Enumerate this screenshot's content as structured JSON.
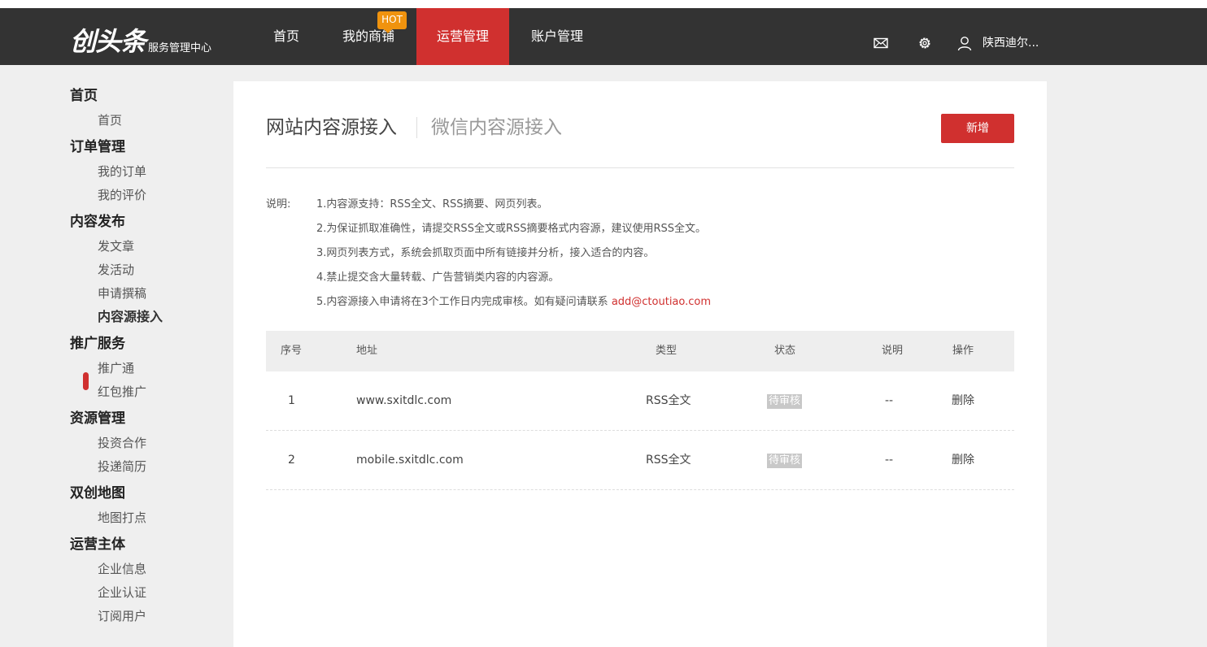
{
  "brand": {
    "name": "创头条",
    "subtitle": "服务管理中心"
  },
  "nav": {
    "items": [
      {
        "label": "首页"
      },
      {
        "label": "我的商铺",
        "badge": "HOT"
      },
      {
        "label": "运营管理",
        "active": true
      },
      {
        "label": "账户管理"
      }
    ]
  },
  "header_right": {
    "icons": [
      "mail-icon",
      "gear-icon",
      "user-icon"
    ],
    "username": "陕西迪尔..."
  },
  "sidebar": {
    "groups": [
      {
        "title": "首页",
        "items": [
          "首页"
        ]
      },
      {
        "title": "订单管理",
        "items": [
          "我的订单",
          "我的评价"
        ]
      },
      {
        "title": "内容发布",
        "items": [
          "发文章",
          "发活动",
          "申请撰稿",
          "内容源接入"
        ]
      },
      {
        "title": "推广服务",
        "items": [
          "推广通",
          "红包推广"
        ]
      },
      {
        "title": "资源管理",
        "items": [
          "投资合作",
          "投递简历"
        ]
      },
      {
        "title": "双创地图",
        "items": [
          "地图打点"
        ]
      },
      {
        "title": "运营主体",
        "items": [
          "企业信息",
          "企业认证",
          "订阅用户"
        ]
      }
    ],
    "active_item": "内容源接入"
  },
  "main": {
    "tabs": [
      {
        "label": "网站内容源接入",
        "active": true
      },
      {
        "label": "微信内容源接入",
        "active": false
      }
    ],
    "new_button": "新增",
    "notes": {
      "label": "说明:",
      "lines": [
        "1.内容源支持：RSS全文、RSS摘要、网页列表。",
        "2.为保证抓取准确性，请提交RSS全文或RSS摘要格式内容源，建议使用RSS全文。",
        "3.网页列表方式，系统会抓取页面中所有链接并分析，接入适合的内容。",
        "4.禁止提交含大量转载、广告营销类内容的内容源。",
        "5.内容源接入申请将在3个工作日内完成审核。如有疑问请联系 "
      ],
      "email": "add@ctoutiao.com"
    },
    "table": {
      "columns": [
        "序号",
        "地址",
        "类型",
        "状态",
        "说明",
        "操作"
      ],
      "rows": [
        {
          "index": "1",
          "address": "www.sxitdlc.com",
          "type": "RSS全文",
          "status": "待审核",
          "note": "--",
          "action": "删除"
        },
        {
          "index": "2",
          "address": "mobile.sxitdlc.com",
          "type": "RSS全文",
          "status": "待审核",
          "note": "--",
          "action": "删除"
        }
      ]
    }
  },
  "colors": {
    "accent": "#d0302f",
    "header_bg": "#333333",
    "hot_badge": "#f0930e",
    "page_bg": "#efefef"
  }
}
